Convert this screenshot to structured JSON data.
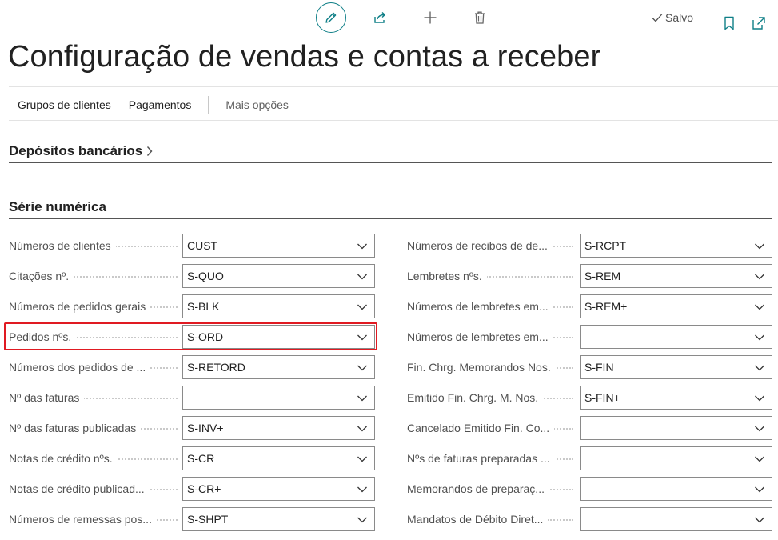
{
  "toolbar": {
    "edit_icon": "pencil-icon",
    "share_icon": "share-icon",
    "new_icon": "plus-icon",
    "delete_icon": "trash-icon",
    "saved_label": "Salvo",
    "bookmark_icon": "bookmark-icon",
    "popout_icon": "open-in-new-window-icon",
    "accent_color": "#0f7f87"
  },
  "page": {
    "title": "Configuração de vendas e contas a receber"
  },
  "actions": {
    "customer_groups": "Grupos de clientes",
    "payments": "Pagamentos",
    "more_options": "Mais opções"
  },
  "sections": {
    "bank_deposits": "Depósitos bancários",
    "number_series": "Série numérica"
  },
  "fields_left": [
    {
      "label": "Números de clientes",
      "value": "CUST"
    },
    {
      "label": "Citações nº.",
      "value": "S-QUO"
    },
    {
      "label": "Números de pedidos gerais",
      "value": "S-BLK"
    },
    {
      "label": "Pedidos nºs.",
      "value": "S-ORD"
    },
    {
      "label": "Números dos pedidos de ...",
      "value": "S-RETORD"
    },
    {
      "label": "Nº das faturas",
      "value": ""
    },
    {
      "label": "Nº das faturas publicadas",
      "value": "S-INV+"
    },
    {
      "label": "Notas de crédito nºs.",
      "value": "S-CR"
    },
    {
      "label": "Notas de crédito publicad...",
      "value": "S-CR+"
    },
    {
      "label": "Números de remessas pos...",
      "value": "S-SHPT"
    }
  ],
  "fields_right": [
    {
      "label": "Números de recibos de de...",
      "value": "S-RCPT"
    },
    {
      "label": "Lembretes nºs.",
      "value": "S-REM"
    },
    {
      "label": "Números de lembretes em...",
      "value": "S-REM+"
    },
    {
      "label": "Números de lembretes em...",
      "value": ""
    },
    {
      "label": "Fin. Chrg. Memorandos Nos.",
      "value": "S-FIN"
    },
    {
      "label": "Emitido Fin. Chrg. M. Nos.",
      "value": "S-FIN+"
    },
    {
      "label": "Cancelado Emitido Fin. Co...",
      "value": ""
    },
    {
      "label": "Nºs de faturas preparadas ...",
      "value": ""
    },
    {
      "label": "Memorandos de preparaç...",
      "value": ""
    },
    {
      "label": "Mandatos de Débito Diret...",
      "value": ""
    }
  ],
  "highlight_color": "#e01a22"
}
